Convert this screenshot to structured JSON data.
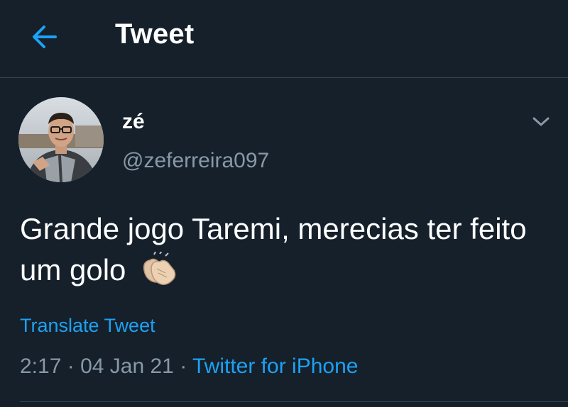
{
  "header": {
    "title": "Tweet",
    "back_icon": "arrow-left-icon"
  },
  "tweet": {
    "author": {
      "display_name": "zé",
      "username": "@zeferreira097"
    },
    "text": "Grande jogo Taremi, merecias ter feito um golo",
    "emoji": "clapping-hands-icon",
    "translate_label": "Translate Tweet",
    "time": "2:17",
    "date": "04 Jan 21",
    "separator": "·",
    "source": "Twitter for iPhone"
  },
  "colors": {
    "background": "#15202b",
    "accent": "#1da1f2",
    "secondary_text": "#8899a6",
    "divider": "#38444d"
  }
}
